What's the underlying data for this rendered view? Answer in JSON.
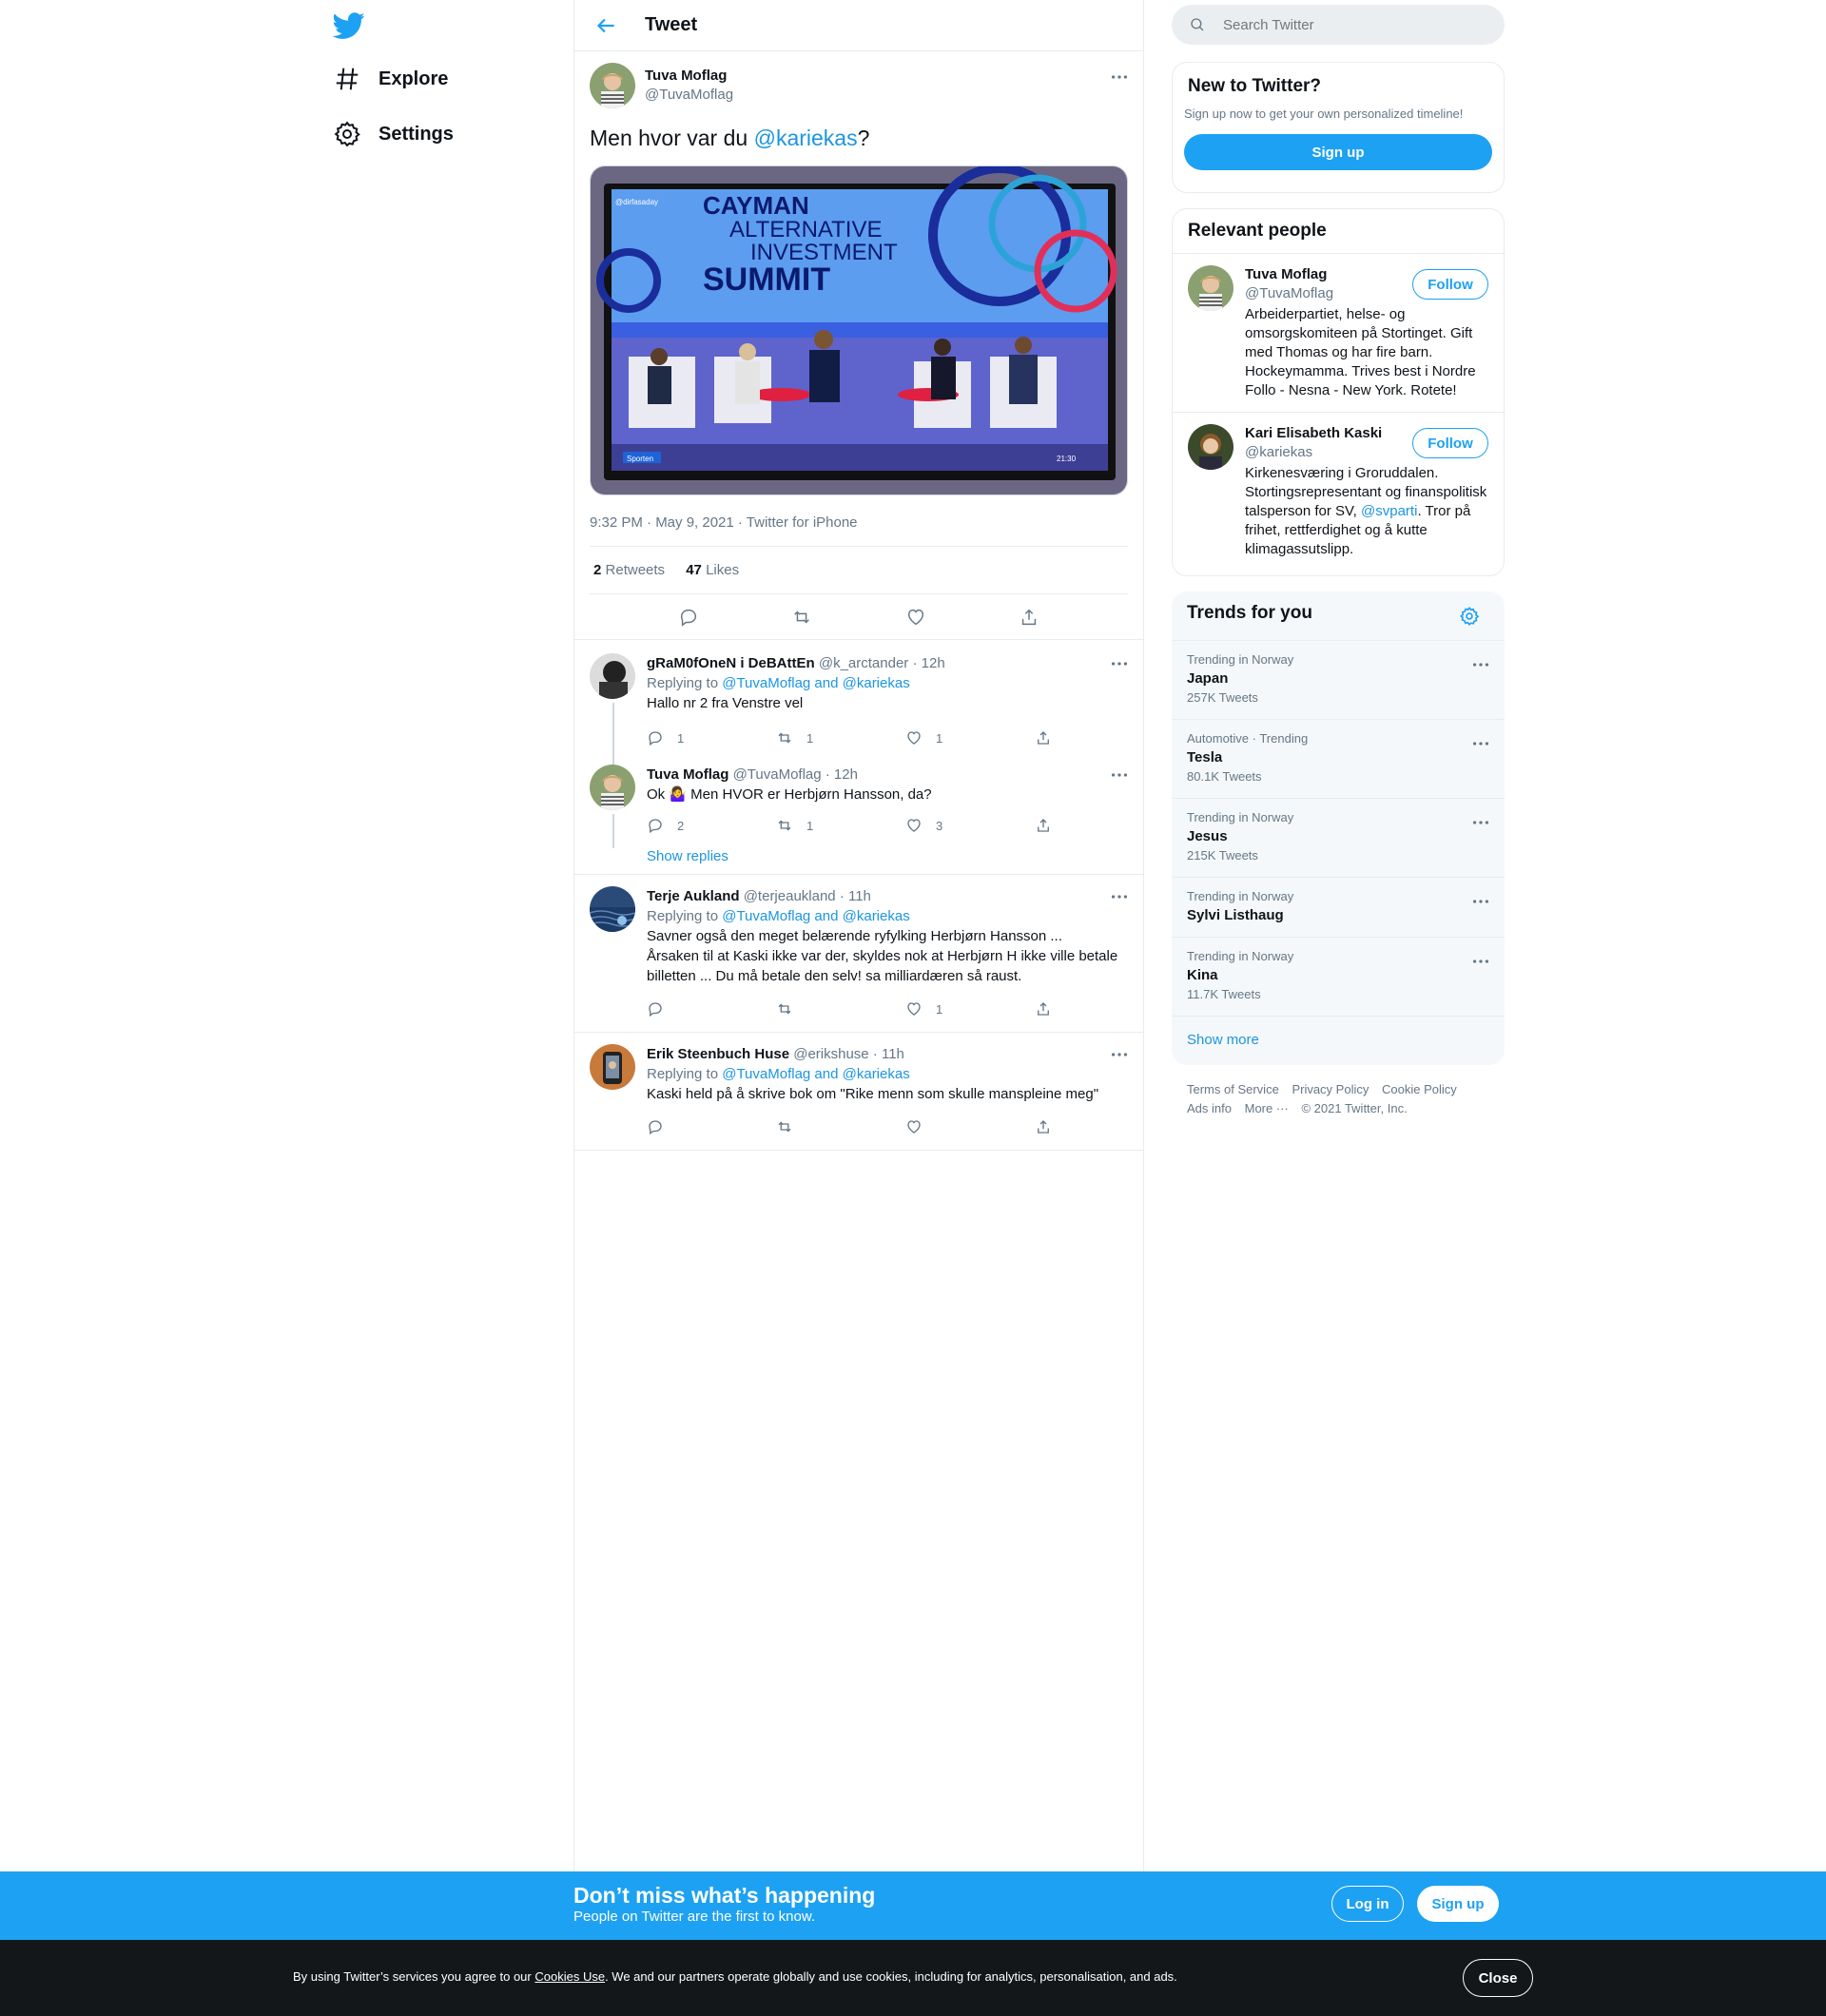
{
  "nav": {
    "explore": "Explore",
    "settings": "Settings"
  },
  "header": {
    "title": "Tweet"
  },
  "tweet": {
    "name": "Tuva Moflag",
    "handle": "@TuvaMoflag",
    "text_prefix": "Men hvor var du ",
    "mention": "@kariekas",
    "text_suffix": "?",
    "media": {
      "line1": "CAYMAN",
      "line2": "ALTERNATIVE",
      "line3": "INVESTMENT",
      "line4": "SUMMIT",
      "tag": "Sporten",
      "time": "21:30",
      "corner": "@dirfasaday"
    },
    "meta": "9:32 PM · May 9, 2021 · Twitter for iPhone",
    "retweets_count": "2",
    "retweets_label": "Retweets",
    "likes_count": "47",
    "likes_label": "Likes"
  },
  "replies": [
    {
      "name": "gRaM0fOneN i DeBAttEn",
      "meta": "@k_arctander · 12h",
      "replying": "Replying to",
      "to": "@TuvaMoflag and @kariekas",
      "text": "Hallo nr 2 fra Venstre vel",
      "reply_count": "1",
      "rt_count": "1",
      "like_count": "1"
    },
    {
      "name": "Tuva Moflag",
      "meta": "@TuvaMoflag · 12h",
      "text": "Ok 🤷‍♀️ Men HVOR er Herbjørn Hansson, da?",
      "reply_count": "2",
      "rt_count": "1",
      "like_count": "3",
      "show_replies": "Show replies"
    },
    {
      "name": "Terje Aukland",
      "meta": "@terjeaukland · 11h",
      "replying": "Replying to",
      "to": "@TuvaMoflag and @kariekas",
      "line1": "Savner også den meget belærende ryfylking Herbjørn Hansson ...",
      "line2": "Årsaken til at Kaski ikke var der, skyldes nok at Herbjørn H ikke ville betale",
      "line3": "billetten ... Du må betale den selv!  sa milliardæren så raust.",
      "like_count": "1"
    },
    {
      "name": "Erik Steenbuch Huse",
      "meta": "@erikshuse · 11h",
      "replying": "Replying to",
      "to": "@TuvaMoflag and @kariekas",
      "text": "Kaski held på å skrive bok om \"Rike menn som skulle manspleine meg\""
    }
  ],
  "search": {
    "placeholder": "Search Twitter"
  },
  "new_to_twitter": {
    "title": "New to Twitter?",
    "subtitle": "Sign up now to get your own personalized timeline!",
    "button": "Sign up"
  },
  "relevant": {
    "title": "Relevant people",
    "people": [
      {
        "name": "Tuva Moflag",
        "handle": "@TuvaMoflag",
        "bio": "Arbeiderpartiet, helse- og omsorgskomiteen på Stortinget. Gift med Thomas og har fire barn. Hockeymamma. Trives best i Nordre Follo - Nesna - New York. Rotete!",
        "button": "Follow"
      },
      {
        "name": "Kari Elisabeth Kaski",
        "handle": "@kariekas",
        "bio_prefix": "Kirkenesværing i Groruddalen. Stortingsrepresentant og finanspolitisk talsperson for SV, ",
        "bio_mention": "@svparti",
        "bio_suffix": ". Tror på frihet, rettferdighet og å kutte klimagassutslipp.",
        "button": "Follow"
      }
    ]
  },
  "trends": {
    "title": "Trends for you",
    "items": [
      {
        "context": "Trending in Norway",
        "name": "Japan",
        "count": "257K Tweets"
      },
      {
        "context": "Automotive · Trending",
        "name": "Tesla",
        "count": "80.1K Tweets"
      },
      {
        "context": "Trending in Norway",
        "name": "Jesus",
        "count": "215K Tweets"
      },
      {
        "context": "Trending in Norway",
        "name": "Sylvi Listhaug",
        "count": ""
      },
      {
        "context": "Trending in Norway",
        "name": "Kina",
        "count": "11.7K Tweets"
      }
    ],
    "show_more": "Show more"
  },
  "footer": {
    "terms": "Terms of Service",
    "privacy": "Privacy Policy",
    "cookie": "Cookie Policy",
    "ads": "Ads info",
    "more": "More ···",
    "copyright": "© 2021 Twitter, Inc."
  },
  "bottom_bar": {
    "title": "Don’t miss what’s happening",
    "subtitle": "People on Twitter are the first to know.",
    "login": "Log in",
    "signup": "Sign up"
  },
  "cookie_bar": {
    "prefix": "By using Twitter’s services you agree to our ",
    "link": "Cookies Use",
    "suffix": ". We and our partners operate globally and use cookies, including for analytics, personalisation, and ads.",
    "close": "Close"
  },
  "colors": {
    "accent": "#1da1f2",
    "link": "#1b95e0",
    "muted": "#657786",
    "cookie_bg": "#14171a"
  }
}
